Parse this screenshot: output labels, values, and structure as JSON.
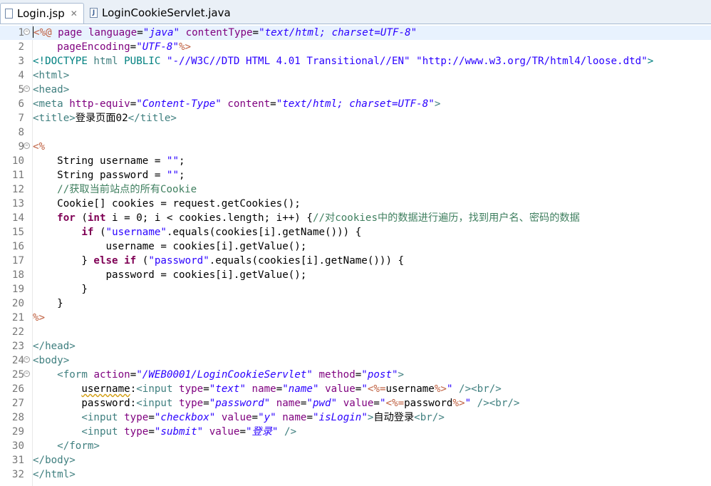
{
  "tabs": [
    {
      "label": "Login.jsp",
      "close": "✕"
    },
    {
      "label": "LoginCookieServlet.java"
    }
  ],
  "lines": [
    {
      "n": "1",
      "segs": [
        [
          "d",
          "<%@"
        ],
        [
          "p",
          " "
        ],
        [
          "a",
          "page"
        ],
        [
          "p",
          " "
        ],
        [
          "a",
          "language"
        ],
        [
          "p",
          "="
        ],
        [
          "v",
          "\"java\""
        ],
        [
          "p",
          " "
        ],
        [
          "a",
          "contentType"
        ],
        [
          "p",
          "="
        ],
        [
          "v",
          "\"text/html; charset=UTF-8\""
        ]
      ]
    },
    {
      "n": "2",
      "segs": [
        [
          "p",
          "    "
        ],
        [
          "a",
          "pageEncoding"
        ],
        [
          "p",
          "="
        ],
        [
          "v",
          "\"UTF-8\""
        ],
        [
          "d",
          "%>"
        ]
      ]
    },
    {
      "n": "3",
      "segs": [
        [
          "dt",
          "<!DOCTYPE "
        ],
        [
          "t",
          "html"
        ],
        [
          "p",
          " "
        ],
        [
          "dt",
          "PUBLIC"
        ],
        [
          "p",
          " "
        ],
        [
          "s",
          "\"-//W3C//DTD HTML 4.01 Transitional//EN\""
        ],
        [
          "p",
          " "
        ],
        [
          "s",
          "\"http://www.w3.org/TR/html4/loose.dtd\""
        ],
        [
          "dt",
          ">"
        ]
      ]
    },
    {
      "n": "4",
      "segs": [
        [
          "t",
          "<html>"
        ]
      ]
    },
    {
      "n": "5",
      "segs": [
        [
          "t",
          "<head>"
        ]
      ]
    },
    {
      "n": "6",
      "segs": [
        [
          "t",
          "<meta"
        ],
        [
          "p",
          " "
        ],
        [
          "a",
          "http-equiv"
        ],
        [
          "p",
          "="
        ],
        [
          "v",
          "\"Content-Type\""
        ],
        [
          "p",
          " "
        ],
        [
          "a",
          "content"
        ],
        [
          "p",
          "="
        ],
        [
          "v",
          "\"text/html; charset=UTF-8\""
        ],
        [
          "t",
          ">"
        ]
      ]
    },
    {
      "n": "7",
      "segs": [
        [
          "t",
          "<title>"
        ],
        [
          "p",
          "登录页面02"
        ],
        [
          "t",
          "</title>"
        ]
      ]
    },
    {
      "n": "8",
      "segs": []
    },
    {
      "n": "9",
      "segs": [
        [
          "d",
          "<%"
        ]
      ]
    },
    {
      "n": "10",
      "segs": [
        [
          "p",
          "    String username = "
        ],
        [
          "s",
          "\"\""
        ],
        [
          "p",
          ";"
        ]
      ]
    },
    {
      "n": "11",
      "segs": [
        [
          "p",
          "    String password = "
        ],
        [
          "s",
          "\"\""
        ],
        [
          "p",
          ";"
        ]
      ]
    },
    {
      "n": "12",
      "segs": [
        [
          "c",
          "    //获取当前站点的所有Cookie"
        ]
      ]
    },
    {
      "n": "13",
      "segs": [
        [
          "p",
          "    Cookie[] cookies = request.getCookies();"
        ]
      ]
    },
    {
      "n": "14",
      "segs": [
        [
          "p",
          "    "
        ],
        [
          "k",
          "for"
        ],
        [
          "p",
          " ("
        ],
        [
          "k",
          "int"
        ],
        [
          "p",
          " i = 0; i < cookies.length; i++) {"
        ],
        [
          "c",
          "//对cookies中的数据进行遍历，找到用户名、密码的数据"
        ]
      ]
    },
    {
      "n": "15",
      "segs": [
        [
          "p",
          "        "
        ],
        [
          "k",
          "if"
        ],
        [
          "p",
          " ("
        ],
        [
          "s",
          "\"username\""
        ],
        [
          "p",
          ".equals(cookies[i].getName())) {"
        ]
      ]
    },
    {
      "n": "16",
      "segs": [
        [
          "p",
          "            username = cookies[i].getValue();"
        ]
      ]
    },
    {
      "n": "17",
      "segs": [
        [
          "p",
          "        } "
        ],
        [
          "k",
          "else"
        ],
        [
          "p",
          " "
        ],
        [
          "k",
          "if"
        ],
        [
          "p",
          " ("
        ],
        [
          "s",
          "\"password\""
        ],
        [
          "p",
          ".equals(cookies[i].getName())) {"
        ]
      ]
    },
    {
      "n": "18",
      "segs": [
        [
          "p",
          "            password = cookies[i].getValue();"
        ]
      ]
    },
    {
      "n": "19",
      "segs": [
        [
          "p",
          "        }"
        ]
      ]
    },
    {
      "n": "20",
      "segs": [
        [
          "p",
          "    }"
        ]
      ]
    },
    {
      "n": "21",
      "segs": [
        [
          "d",
          "%>"
        ]
      ]
    },
    {
      "n": "22",
      "segs": []
    },
    {
      "n": "23",
      "segs": [
        [
          "t",
          "</head>"
        ]
      ]
    },
    {
      "n": "24",
      "segs": [
        [
          "t",
          "<body>"
        ]
      ]
    },
    {
      "n": "25",
      "segs": [
        [
          "p",
          "    "
        ],
        [
          "t",
          "<form"
        ],
        [
          "p",
          " "
        ],
        [
          "a",
          "action"
        ],
        [
          "p",
          "="
        ],
        [
          "v",
          "\"/WEB0001/LoginCookieServlet\""
        ],
        [
          "p",
          " "
        ],
        [
          "a",
          "method"
        ],
        [
          "p",
          "="
        ],
        [
          "v",
          "\"post\""
        ],
        [
          "t",
          ">"
        ]
      ]
    },
    {
      "n": "26",
      "segs": [
        [
          "p",
          "        "
        ],
        [
          "u",
          "username"
        ],
        [
          "p",
          ":"
        ],
        [
          "t",
          "<input"
        ],
        [
          "p",
          " "
        ],
        [
          "a",
          "type"
        ],
        [
          "p",
          "="
        ],
        [
          "v",
          "\"text\""
        ],
        [
          "p",
          " "
        ],
        [
          "a",
          "name"
        ],
        [
          "p",
          "="
        ],
        [
          "v",
          "\"name\""
        ],
        [
          "p",
          " "
        ],
        [
          "a",
          "value"
        ],
        [
          "p",
          "="
        ],
        [
          "s",
          "\""
        ],
        [
          "d",
          "<%="
        ],
        [
          "p",
          "username"
        ],
        [
          "d",
          "%>"
        ],
        [
          "s",
          "\""
        ],
        [
          "p",
          " "
        ],
        [
          "t",
          "/><br/>"
        ]
      ]
    },
    {
      "n": "27",
      "segs": [
        [
          "p",
          "        password:"
        ],
        [
          "t",
          "<input"
        ],
        [
          "p",
          " "
        ],
        [
          "a",
          "type"
        ],
        [
          "p",
          "="
        ],
        [
          "v",
          "\"password\""
        ],
        [
          "p",
          " "
        ],
        [
          "a",
          "name"
        ],
        [
          "p",
          "="
        ],
        [
          "v",
          "\"pwd\""
        ],
        [
          "p",
          " "
        ],
        [
          "a",
          "value"
        ],
        [
          "p",
          "="
        ],
        [
          "s",
          "\""
        ],
        [
          "d",
          "<%="
        ],
        [
          "p",
          "password"
        ],
        [
          "d",
          "%>"
        ],
        [
          "s",
          "\""
        ],
        [
          "p",
          " "
        ],
        [
          "t",
          "/><br/>"
        ]
      ]
    },
    {
      "n": "28",
      "segs": [
        [
          "p",
          "        "
        ],
        [
          "t",
          "<input"
        ],
        [
          "p",
          " "
        ],
        [
          "a",
          "type"
        ],
        [
          "p",
          "="
        ],
        [
          "v",
          "\"checkbox\""
        ],
        [
          "p",
          " "
        ],
        [
          "a",
          "value"
        ],
        [
          "p",
          "="
        ],
        [
          "v",
          "\"y\""
        ],
        [
          "p",
          " "
        ],
        [
          "a",
          "name"
        ],
        [
          "p",
          "="
        ],
        [
          "v",
          "\"isLogin\""
        ],
        [
          "t",
          ">"
        ],
        [
          "p",
          "自动登录"
        ],
        [
          "t",
          "<br/>"
        ]
      ]
    },
    {
      "n": "29",
      "segs": [
        [
          "p",
          "        "
        ],
        [
          "t",
          "<input"
        ],
        [
          "p",
          " "
        ],
        [
          "a",
          "type"
        ],
        [
          "p",
          "="
        ],
        [
          "v",
          "\"submit\""
        ],
        [
          "p",
          " "
        ],
        [
          "a",
          "value"
        ],
        [
          "p",
          "="
        ],
        [
          "v",
          "\"登录\""
        ],
        [
          "p",
          " "
        ],
        [
          "t",
          "/>"
        ]
      ]
    },
    {
      "n": "30",
      "segs": [
        [
          "p",
          "    "
        ],
        [
          "t",
          "</form>"
        ]
      ]
    },
    {
      "n": "31",
      "segs": [
        [
          "t",
          "</body>"
        ]
      ]
    },
    {
      "n": "32",
      "segs": [
        [
          "t",
          "</html>"
        ]
      ]
    }
  ],
  "folds": [
    "1",
    "5",
    "9",
    "24",
    "25"
  ]
}
